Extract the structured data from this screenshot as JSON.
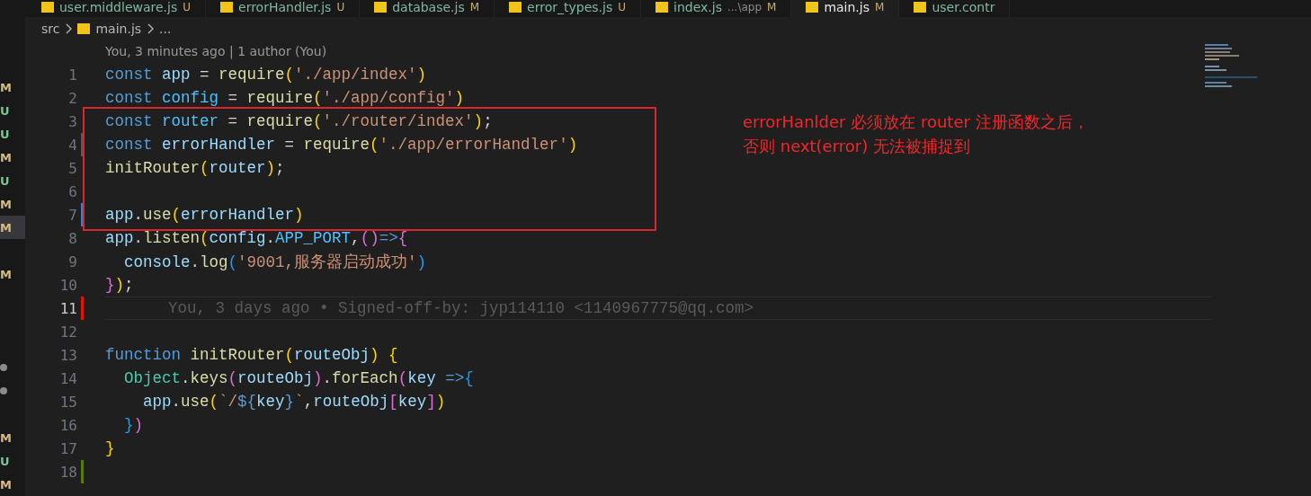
{
  "tabs": [
    {
      "label": "user.middleware.js",
      "status": "U",
      "selected": false
    },
    {
      "label": "errorHandler.js",
      "status": "U",
      "selected": false
    },
    {
      "label": "database.js",
      "status": "M",
      "selected": false
    },
    {
      "label": "error_types.js",
      "status": "U",
      "selected": false
    },
    {
      "label": "index.js",
      "path": "...\\app",
      "status": "M",
      "selected": false
    },
    {
      "label": "main.js",
      "status": "M",
      "selected": true
    },
    {
      "label": "user.contr",
      "selected": false
    }
  ],
  "breadcrumb": [
    "src",
    "main.js",
    "..."
  ],
  "codelens": "You, 3 minutes ago | 1 author (You)",
  "scm_gutter": [
    {
      "mark": "M",
      "kind": "letter",
      "highlighted": false
    },
    {
      "mark": "U",
      "kind": "letter",
      "highlighted": false
    },
    {
      "mark": "U",
      "kind": "letter",
      "highlighted": false
    },
    {
      "mark": "M",
      "kind": "letter",
      "highlighted": false
    },
    {
      "mark": "U",
      "kind": "letter",
      "highlighted": false
    },
    {
      "mark": "M",
      "kind": "letter",
      "highlighted": false
    },
    {
      "mark": "M",
      "kind": "letter",
      "highlighted": true
    },
    {
      "kind": "empty",
      "highlighted": false
    },
    {
      "mark": "M",
      "kind": "letter",
      "highlighted": false
    },
    {
      "kind": "empty",
      "highlighted": false
    },
    {
      "kind": "empty",
      "highlighted": false
    },
    {
      "kind": "empty",
      "highlighted": false
    },
    {
      "kind": "dot",
      "highlighted": false
    },
    {
      "kind": "dot",
      "highlighted": false
    },
    {
      "kind": "empty",
      "highlighted": false
    },
    {
      "mark": "M",
      "kind": "letter",
      "highlighted": false
    },
    {
      "mark": "U",
      "kind": "letter",
      "highlighted": false
    },
    {
      "mark": "M",
      "kind": "letter",
      "highlighted": false
    }
  ],
  "lines": [
    {
      "number": "1",
      "current": false,
      "tokens": [
        {
          "text": "const ",
          "kind": "keyword"
        },
        {
          "text": "app",
          "kind": "variable"
        },
        {
          "text": " = ",
          "kind": "plain"
        },
        {
          "text": "require",
          "kind": "function"
        },
        {
          "text": "(",
          "kind": "bracket"
        },
        {
          "text": "'./app/index'",
          "kind": "string"
        },
        {
          "text": ")",
          "kind": "bracket"
        }
      ]
    },
    {
      "number": "2",
      "current": false,
      "tokens": [
        {
          "text": "const ",
          "kind": "keyword"
        },
        {
          "text": "config",
          "kind": "constant"
        },
        {
          "text": " = ",
          "kind": "plain"
        },
        {
          "text": "require",
          "kind": "function"
        },
        {
          "text": "(",
          "kind": "bracket"
        },
        {
          "text": "'./app/config'",
          "kind": "string"
        },
        {
          "text": ")",
          "kind": "bracket"
        }
      ]
    },
    {
      "number": "3",
      "current": false,
      "tokens": [
        {
          "text": "const ",
          "kind": "keyword"
        },
        {
          "text": "router",
          "kind": "constant"
        },
        {
          "text": " = ",
          "kind": "plain"
        },
        {
          "text": "require",
          "kind": "function"
        },
        {
          "text": "(",
          "kind": "bracket"
        },
        {
          "text": "'./router/index'",
          "kind": "string"
        },
        {
          "text": ")",
          "kind": "bracket"
        },
        {
          "text": ";",
          "kind": "plain"
        }
      ]
    },
    {
      "number": "4",
      "color": "#5a5a5a",
      "current": false,
      "tokens": [
        {
          "text": "const ",
          "kind": "keyword"
        },
        {
          "text": "errorHandler",
          "kind": "variable"
        },
        {
          "text": " = ",
          "kind": "plain"
        },
        {
          "text": "require",
          "kind": "function"
        },
        {
          "text": "(",
          "kind": "bracket"
        },
        {
          "text": "'./app/errorHandler'",
          "kind": "string"
        },
        {
          "text": ")",
          "kind": "bracket"
        }
      ]
    },
    {
      "number": "5",
      "current": false,
      "tokens": [
        {
          "text": "initRouter",
          "kind": "function"
        },
        {
          "text": "(",
          "kind": "bracket"
        },
        {
          "text": "router",
          "kind": "variable"
        },
        {
          "text": ")",
          "kind": "bracket"
        },
        {
          "text": ";",
          "kind": "plain"
        }
      ]
    },
    {
      "number": "6",
      "current": false
    },
    {
      "number": "7",
      "color": "#2488db",
      "current": false,
      "tokens": [
        {
          "text": "app",
          "kind": "variable"
        },
        {
          "text": ".",
          "kind": "plain"
        },
        {
          "text": "use",
          "kind": "function"
        },
        {
          "text": "(",
          "kind": "bracket"
        },
        {
          "text": "errorHandler",
          "kind": "variable"
        },
        {
          "text": ")",
          "kind": "bracket"
        }
      ]
    },
    {
      "number": "8",
      "current": false,
      "tokens": [
        {
          "text": "app",
          "kind": "variable"
        },
        {
          "text": ".",
          "kind": "plain"
        },
        {
          "text": "listen",
          "kind": "function"
        },
        {
          "text": "(",
          "kind": "bracket"
        },
        {
          "text": "config",
          "kind": "variable"
        },
        {
          "text": ".",
          "kind": "plain"
        },
        {
          "text": "APP_PORT",
          "kind": "constant"
        },
        {
          "text": ",",
          "kind": "plain"
        },
        {
          "text": "()",
          "kind": "bracket2"
        },
        {
          "text": "=>",
          "kind": "keyword"
        },
        {
          "text": "{",
          "kind": "bracket2"
        }
      ]
    },
    {
      "number": "9",
      "current": false,
      "tokens": [
        {
          "text": "  console",
          "kind": "variable"
        },
        {
          "text": ".",
          "kind": "plain"
        },
        {
          "text": "log",
          "kind": "function"
        },
        {
          "text": "(",
          "kind": "bracket3"
        },
        {
          "text": "'9001,服务器启动成功'",
          "kind": "string"
        },
        {
          "text": ")",
          "kind": "bracket3"
        }
      ]
    },
    {
      "number": "10",
      "current": false,
      "tokens": [
        {
          "text": "}",
          "kind": "bracket2"
        },
        {
          "text": ")",
          "kind": "bracket"
        },
        {
          "text": ";",
          "kind": "plain"
        }
      ]
    },
    {
      "number": "11",
      "color": "#e51400",
      "current": true,
      "blame": "You, 3 days ago • Signed-off-by: jyp114110 <1140967775@qq.com>"
    },
    {
      "number": "12",
      "current": false
    },
    {
      "number": "13",
      "current": false,
      "tokens": [
        {
          "text": "function ",
          "kind": "keyword"
        },
        {
          "text": "initRouter",
          "kind": "function"
        },
        {
          "text": "(",
          "kind": "bracket"
        },
        {
          "text": "routeObj",
          "kind": "variable"
        },
        {
          "text": ") {",
          "kind": "bracket"
        }
      ]
    },
    {
      "number": "14",
      "current": false,
      "tokens": [
        {
          "text": "  Object",
          "kind": "class"
        },
        {
          "text": ".",
          "kind": "plain"
        },
        {
          "text": "keys",
          "kind": "function"
        },
        {
          "text": "(",
          "kind": "bracket2"
        },
        {
          "text": "routeObj",
          "kind": "variable"
        },
        {
          "text": ")",
          "kind": "bracket2"
        },
        {
          "text": ".",
          "kind": "plain"
        },
        {
          "text": "forEach",
          "kind": "function"
        },
        {
          "text": "(",
          "kind": "bracket2"
        },
        {
          "text": "key",
          "kind": "variable"
        },
        {
          "text": " =>",
          "kind": "keyword"
        },
        {
          "text": "{",
          "kind": "bracket3"
        }
      ]
    },
    {
      "number": "15",
      "current": false,
      "tokens": [
        {
          "text": "    app",
          "kind": "variable"
        },
        {
          "text": ".",
          "kind": "plain"
        },
        {
          "text": "use",
          "kind": "function"
        },
        {
          "text": "(",
          "kind": "bracket"
        },
        {
          "text": "`/",
          "kind": "string"
        },
        {
          "text": "${",
          "kind": "keyword"
        },
        {
          "text": "key",
          "kind": "variable"
        },
        {
          "text": "}",
          "kind": "keyword"
        },
        {
          "text": "`",
          "kind": "string"
        },
        {
          "text": ",",
          "kind": "plain"
        },
        {
          "text": "routeObj",
          "kind": "variable"
        },
        {
          "text": "[",
          "kind": "bracket2"
        },
        {
          "text": "key",
          "kind": "variable"
        },
        {
          "text": "]",
          "kind": "bracket2"
        },
        {
          "text": ")",
          "kind": "bracket"
        }
      ]
    },
    {
      "number": "16",
      "current": false,
      "tokens": [
        {
          "text": "  }",
          "kind": "bracket3"
        },
        {
          "text": ")",
          "kind": "bracket2"
        }
      ]
    },
    {
      "number": "17",
      "current": false,
      "tokens": [
        {
          "text": "}",
          "kind": "bracket"
        }
      ]
    },
    {
      "number": "18",
      "color": "#587c0c",
      "current": false
    }
  ],
  "annotation": {
    "lines": [
      "errorHanlder 必须放在 router 注册函数之后，",
      "否则 next(error) 无法被捕捉到"
    ]
  }
}
